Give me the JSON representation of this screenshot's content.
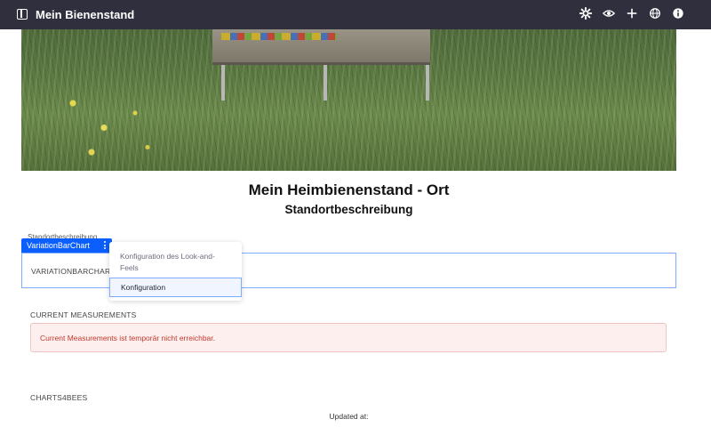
{
  "header": {
    "title": "Mein Bienenstand",
    "icons": [
      "sidebar-toggle-icon",
      "gear-icon",
      "eye-icon",
      "plus-icon",
      "globe-icon",
      "info-icon"
    ]
  },
  "page": {
    "title": "Mein Heimbienenstand - Ort",
    "subtitle": "Standortbeschreibung"
  },
  "widget": {
    "description_label": "Standortbeschreibung",
    "tag_label": "VariationBarChart",
    "box_label": "VARIATIONBARCHART"
  },
  "menu": {
    "items": [
      "Konfiguration des Look-and-Feels",
      "Konfiguration"
    ]
  },
  "current": {
    "label": "CURRENT MEASUREMENTS",
    "alert": "Current Measurements ist temporär nicht erreichbar."
  },
  "charts": {
    "label": "CHARTS4BEES",
    "updated": "Updated at:"
  },
  "colors": {
    "topbar": "#2f2f3d",
    "accent": "#0b5fff",
    "alert_bg": "#feefef",
    "alert_text": "#c0392b"
  }
}
